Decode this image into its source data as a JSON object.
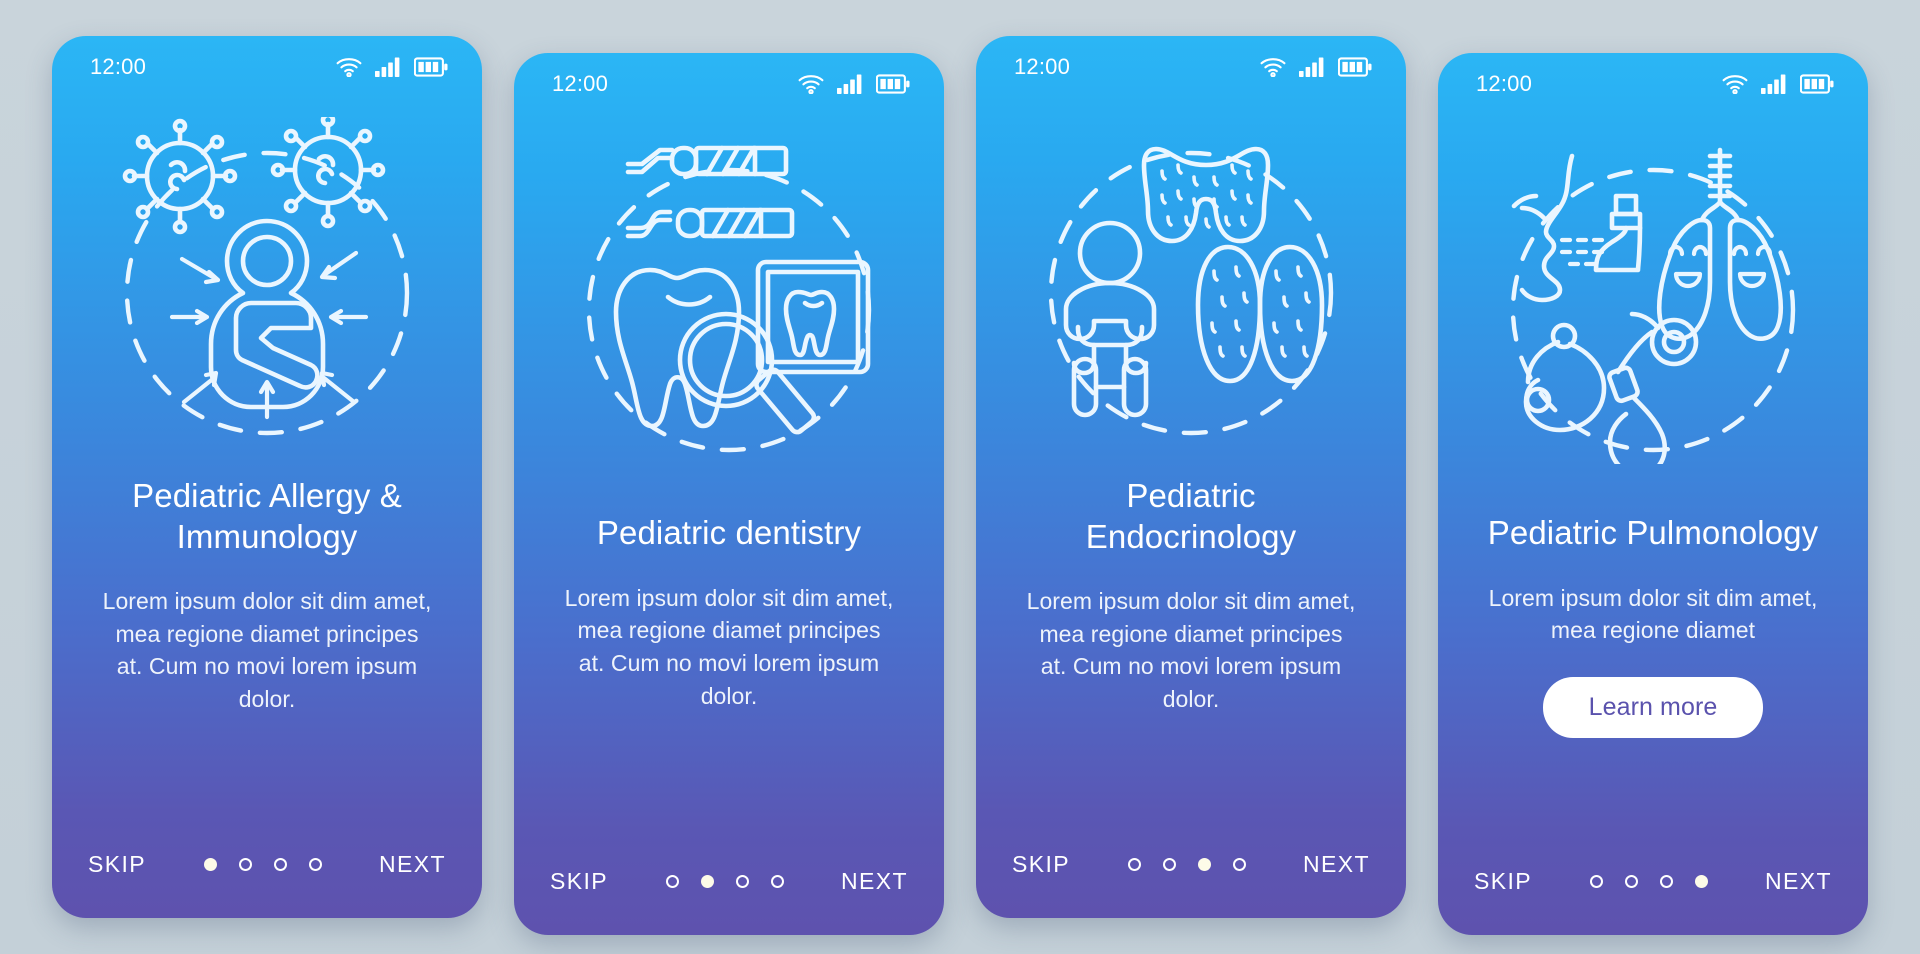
{
  "background_color": "#c6d2da",
  "gradient": {
    "top": "#2bb6f5",
    "bottom": "#5e52ae"
  },
  "accent_color": "#5a52ad",
  "status_bar": {
    "time": "12:00",
    "icons": [
      "wifi-icon",
      "cellular-signal-icon",
      "battery-icon"
    ]
  },
  "nav": {
    "skip_label": "SKIP",
    "next_label": "NEXT",
    "dot_count": 4
  },
  "screens": [
    {
      "id": "pediatric-allergy-immunology",
      "illustration": "allergy-virus-child-icon",
      "title": "Pediatric Allergy & Immunology",
      "body": "Lorem ipsum dolor sit dim amet, mea regione diamet principes at. Cum no movi lorem ipsum dolor.",
      "active_dot": 1,
      "cta": null
    },
    {
      "id": "pediatric-dentistry",
      "illustration": "dental-tooth-tools-xray-icon",
      "title": "Pediatric dentistry",
      "body": "Lorem ipsum dolor sit dim amet, mea regione diamet principes at. Cum no movi lorem ipsum dolor.",
      "active_dot": 2,
      "cta": null
    },
    {
      "id": "pediatric-endocrinology",
      "illustration": "thyroid-adrenal-child-icon",
      "title": "Pediatric Endocrinology",
      "body": "Lorem ipsum dolor sit dim amet, mea regione diamet principes at. Cum no movi lorem ipsum dolor.",
      "active_dot": 3,
      "cta": null
    },
    {
      "id": "pediatric-pulmonology",
      "illustration": "lungs-inhaler-stethoscope-icon",
      "title": "Pediatric Pulmonology",
      "body": "Lorem ipsum dolor sit dim amet, mea regione diamet",
      "active_dot": 4,
      "cta": "Learn more"
    }
  ]
}
